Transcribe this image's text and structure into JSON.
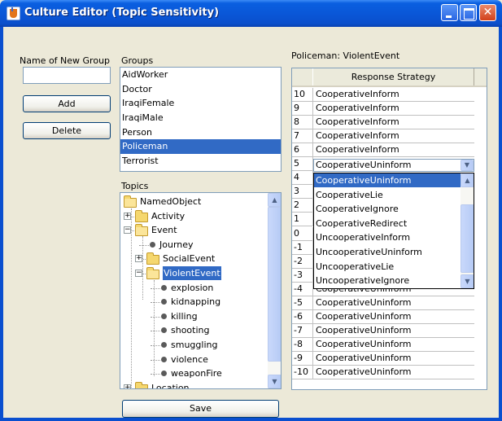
{
  "window": {
    "title": "Culture Editor (Topic Sensitivity)",
    "close_glyph": "✕"
  },
  "left": {
    "new_group_label": "Name of New Group",
    "new_group_value": "",
    "add_label": "Add",
    "delete_label": "Delete"
  },
  "groups": {
    "label": "Groups",
    "items": [
      "AidWorker",
      "Doctor",
      "IraqiFemale",
      "IraqiMale",
      "Person",
      "Policeman",
      "Terrorist"
    ],
    "selected": "Policeman"
  },
  "topics": {
    "label": "Topics",
    "nodes": [
      {
        "text": "NamedObject",
        "kind": "folder-open",
        "toggle": ""
      },
      {
        "text": "Activity",
        "kind": "folder",
        "toggle": "+"
      },
      {
        "text": "Event",
        "kind": "folder-open",
        "toggle": "−"
      },
      {
        "text": "Journey",
        "kind": "leaf",
        "toggle": ""
      },
      {
        "text": "SocialEvent",
        "kind": "folder",
        "toggle": "+"
      },
      {
        "text": "ViolentEvent",
        "kind": "folder-open",
        "toggle": "−",
        "selected": true
      },
      {
        "text": "explosion",
        "kind": "leaf",
        "toggle": ""
      },
      {
        "text": "kidnapping",
        "kind": "leaf",
        "toggle": ""
      },
      {
        "text": "killing",
        "kind": "leaf",
        "toggle": ""
      },
      {
        "text": "shooting",
        "kind": "leaf",
        "toggle": ""
      },
      {
        "text": "smuggling",
        "kind": "leaf",
        "toggle": ""
      },
      {
        "text": "violence",
        "kind": "leaf",
        "toggle": ""
      },
      {
        "text": "weaponFire",
        "kind": "leaf",
        "toggle": ""
      },
      {
        "text": "Location",
        "kind": "folder",
        "toggle": "+"
      }
    ]
  },
  "strategy": {
    "caption": "Policeman: ViolentEvent",
    "column_header": "Response Strategy",
    "rows": [
      {
        "level": "10",
        "value": "CooperativeInform"
      },
      {
        "level": "9",
        "value": "CooperativeInform"
      },
      {
        "level": "8",
        "value": "CooperativeInform"
      },
      {
        "level": "7",
        "value": "CooperativeInform"
      },
      {
        "level": "6",
        "value": "CooperativeInform"
      },
      {
        "level": "5",
        "value": "CooperativeUninform"
      },
      {
        "level": "4",
        "value": ""
      },
      {
        "level": "3",
        "value": ""
      },
      {
        "level": "2",
        "value": ""
      },
      {
        "level": "1",
        "value": ""
      },
      {
        "level": "0",
        "value": ""
      },
      {
        "level": "-1",
        "value": ""
      },
      {
        "level": "-2",
        "value": ""
      },
      {
        "level": "-3",
        "value": ""
      },
      {
        "level": "-4",
        "value": "CooperativeUninform"
      },
      {
        "level": "-5",
        "value": "CooperativeUninform"
      },
      {
        "level": "-6",
        "value": "CooperativeUninform"
      },
      {
        "level": "-7",
        "value": "CooperativeUninform"
      },
      {
        "level": "-8",
        "value": "CooperativeUninform"
      },
      {
        "level": "-9",
        "value": "CooperativeUninform"
      },
      {
        "level": "-10",
        "value": "CooperativeUninform"
      }
    ],
    "combo_value": "CooperativeUninform",
    "dropdown_options": [
      "CooperativeUninform",
      "CooperativeLie",
      "CooperativeIgnore",
      "CooperativeRedirect",
      "UncooperativeInform",
      "UncooperativeUninform",
      "UncooperativeLie",
      "UncooperativeIgnore"
    ],
    "dropdown_selected": "CooperativeUninform"
  },
  "save_label": "Save",
  "colors": {
    "selection": "#316AC5",
    "titlebar": "#0A57D8",
    "window_bg": "#ECE9D8"
  },
  "icons": [
    "java-app-icon",
    "minimize-icon",
    "maximize-icon",
    "close-icon",
    "folder-icon",
    "leaf-node-icon",
    "scroll-up-arrow-icon",
    "scroll-down-arrow-icon",
    "dropdown-arrow-icon"
  ]
}
